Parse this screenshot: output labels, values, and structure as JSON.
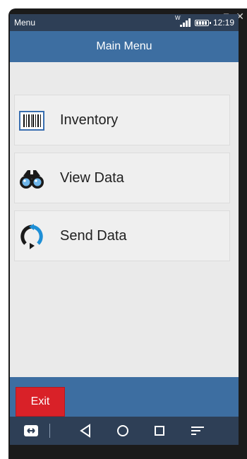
{
  "window": {
    "chrome_icons": [
      "external-link-icon",
      "close-icon"
    ]
  },
  "statusbar": {
    "app_label": "Menu",
    "network_letter": "W",
    "time": "12:19"
  },
  "header": {
    "title": "Main Menu"
  },
  "menu": {
    "items": [
      {
        "label": "Inventory",
        "icon": "barcode-icon"
      },
      {
        "label": "View Data",
        "icon": "binoculars-icon"
      },
      {
        "label": "Send Data",
        "icon": "sync-icon"
      }
    ]
  },
  "footer": {
    "exit_label": "Exit"
  },
  "navbar": {
    "buttons": [
      "app-switch-icon",
      "back-icon",
      "home-icon",
      "recents-icon",
      "menu-icon"
    ]
  },
  "colors": {
    "header_blue": "#3d6ea1",
    "status_dark": "#2e3f56",
    "exit_red": "#d92128",
    "menu_bg": "#eaeaea"
  }
}
